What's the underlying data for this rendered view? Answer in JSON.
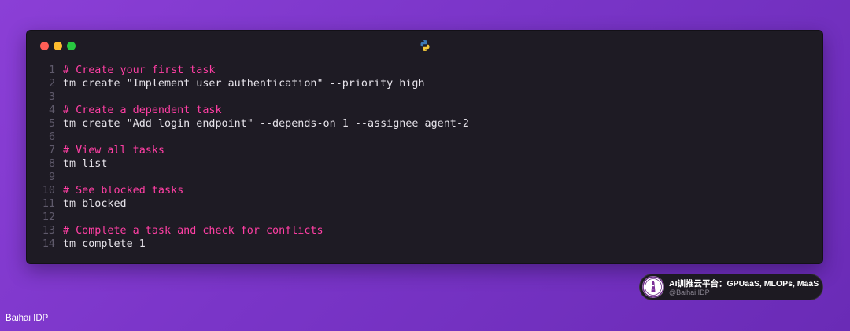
{
  "window": {
    "traffic_lights": [
      "close",
      "minimize",
      "zoom"
    ],
    "icon": "python-logo-icon"
  },
  "code": {
    "lines": [
      {
        "num": "1",
        "text": "# Create your first task",
        "type": "comment"
      },
      {
        "num": "2",
        "text": "tm create \"Implement user authentication\" --priority high",
        "type": "code"
      },
      {
        "num": "3",
        "text": "",
        "type": "code"
      },
      {
        "num": "4",
        "text": "# Create a dependent task",
        "type": "comment"
      },
      {
        "num": "5",
        "text": "tm create \"Add login endpoint\" --depends-on 1 --assignee agent-2",
        "type": "code"
      },
      {
        "num": "6",
        "text": "",
        "type": "code"
      },
      {
        "num": "7",
        "text": "# View all tasks",
        "type": "comment"
      },
      {
        "num": "8",
        "text": "tm list",
        "type": "code"
      },
      {
        "num": "9",
        "text": "",
        "type": "code"
      },
      {
        "num": "10",
        "text": "# See blocked tasks",
        "type": "comment"
      },
      {
        "num": "11",
        "text": "tm blocked",
        "type": "code"
      },
      {
        "num": "12",
        "text": "",
        "type": "code"
      },
      {
        "num": "13",
        "text": "# Complete a task and check for conflicts",
        "type": "comment"
      },
      {
        "num": "14",
        "text": "tm complete 1",
        "type": "code"
      }
    ]
  },
  "profile": {
    "title": "AI训推云平台：GPUaaS, MLOPs, MaaS",
    "handle": "@Baihai IDP",
    "avatar_icon": "lighthouse-logo-icon"
  },
  "watermark": "Baihai IDP",
  "colors": {
    "background": "#7a35c8",
    "window": "#1e1b24",
    "comment": "#ff3fa4",
    "code_text": "#e6e3ea",
    "line_number": "#5f5a6b"
  }
}
